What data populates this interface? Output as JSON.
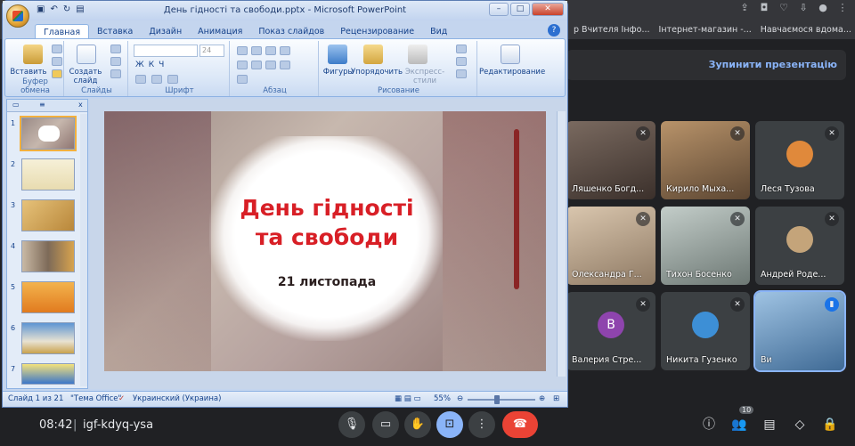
{
  "browser": {
    "bookmarks": [
      "р Вчителя Інфо...",
      "Інтернет-магазин -...",
      "Навчаємося вдома..."
    ],
    "more_label": "»",
    "tool_icons": [
      "share-icon",
      "camera-icon",
      "heart-icon",
      "profile-icon",
      "menu-icon"
    ]
  },
  "meet": {
    "stop_presentation": "Зупинити презентацію",
    "participants": [
      {
        "name": "Ляшенко Богд...",
        "video": true,
        "muted": true,
        "color": "#5b4a42"
      },
      {
        "name": "Кирило Мыха...",
        "video": true,
        "muted": true,
        "color": "#8b6f4e"
      },
      {
        "name": "Леся Тузова",
        "video": false,
        "muted": true,
        "avatar_color": "#e0893b"
      },
      {
        "name": "Олександра Г...",
        "video": true,
        "muted": true,
        "color": "#c9b49a"
      },
      {
        "name": "Тихон Босенко",
        "video": true,
        "muted": true,
        "color": "#9aa7a3"
      },
      {
        "name": "Андрей Роде...",
        "video": false,
        "muted": true,
        "avatar_color": "#c4a47a"
      },
      {
        "name": "Валерия Стре...",
        "video": false,
        "muted": true,
        "avatar_letter": "В",
        "avatar_color": "#8e44ad"
      },
      {
        "name": "Никита Гузенко",
        "video": false,
        "muted": true,
        "avatar_color": "#3d8fd6"
      },
      {
        "name": "Ви",
        "video": true,
        "muted": false,
        "speaking": true,
        "color": "#4f7fb0"
      }
    ],
    "time": "08:42",
    "separator": "|",
    "meeting_code": "igf-kdyq-ysa",
    "participants_count": "10",
    "controls": [
      "mic-icon",
      "camera-icon",
      "raise-hand-icon",
      "present-icon",
      "more-icon",
      "hang-up-icon"
    ],
    "right_controls": [
      "info-icon",
      "people-icon",
      "chat-icon",
      "activities-icon",
      "host-controls-icon"
    ]
  },
  "ppt": {
    "title": "День гідності та свободи.pptx - Microsoft PowerPoint",
    "tabs": [
      "Главная",
      "Вставка",
      "Дизайн",
      "Анимация",
      "Показ слайдов",
      "Рецензирование",
      "Вид"
    ],
    "active_tab": "Главная",
    "ribbon": {
      "paste": "Вставить",
      "clipboard": "Буфер обмена",
      "create_slide": "Создать слайд",
      "slides": "Слайды",
      "font_size": "24",
      "font": "Шрифт",
      "paragraph": "Абзац",
      "shapes": "Фигуры",
      "arrange": "Упорядочить",
      "quick_styles": "Экспресс-стили",
      "drawing": "Рисование",
      "editing": "Редактирование"
    },
    "slide_numbers": [
      "1",
      "2",
      "3",
      "4",
      "5",
      "6",
      "7"
    ],
    "slide": {
      "title_line1": "День гідності",
      "title_line2": "та свободи",
      "subtitle": "21 листопада"
    },
    "status": {
      "slide_of": "Слайд 1 из 21",
      "theme": "\"Тема Office\"",
      "language": "Украинский (Украина)",
      "zoom": "55%"
    }
  }
}
